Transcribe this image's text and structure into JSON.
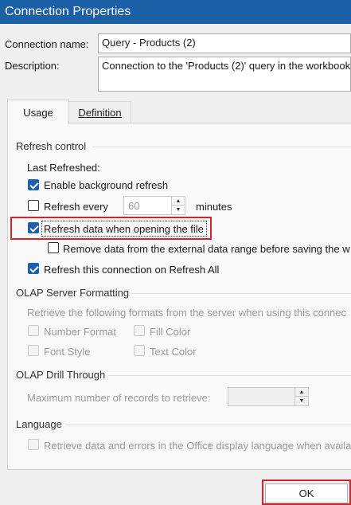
{
  "window": {
    "title": "Connection Properties"
  },
  "connection": {
    "name_label": "Connection name:",
    "name_value": "Query - Products (2)",
    "description_label": "Description:",
    "description_value": "Connection to the 'Products (2)' query in the workbook."
  },
  "tabs": [
    {
      "label": "Usage",
      "active": true
    },
    {
      "label": "Definition",
      "active": false
    }
  ],
  "refresh": {
    "section_label": "Refresh control",
    "last_refreshed_label": "Last Refreshed:",
    "background_refresh": {
      "label": "Enable background refresh",
      "checked": true
    },
    "refresh_every": {
      "label": "Refresh every",
      "checked": false,
      "value": "60",
      "unit": "minutes"
    },
    "refresh_on_open": {
      "label": "Refresh data when opening the file",
      "checked": true
    },
    "remove_data": {
      "label": "Remove data from the external data range before saving the w",
      "checked": false
    },
    "refresh_all": {
      "label": "Refresh this connection on Refresh All",
      "checked": true
    }
  },
  "olap_formatting": {
    "section_label": "OLAP Server Formatting",
    "description": "Retrieve the following formats from the server when using this connec",
    "number_format": "Number Format",
    "fill_color": "Fill Color",
    "font_style": "Font Style",
    "text_color": "Text Color"
  },
  "olap_drill": {
    "section_label": "OLAP Drill Through",
    "max_records_label": "Maximum number of records to retrieve:",
    "max_records_value": ""
  },
  "language": {
    "section_label": "Language",
    "retrieve_label": "Retrieve data and errors in the Office display language when availa"
  },
  "buttons": {
    "ok": "OK"
  },
  "colors": {
    "titlebar": "#1b5fa6",
    "check_fill": "#1a5fb4",
    "highlight": "#d0262b"
  },
  "icons": {
    "spin_up": "▲",
    "spin_down": "▼"
  }
}
